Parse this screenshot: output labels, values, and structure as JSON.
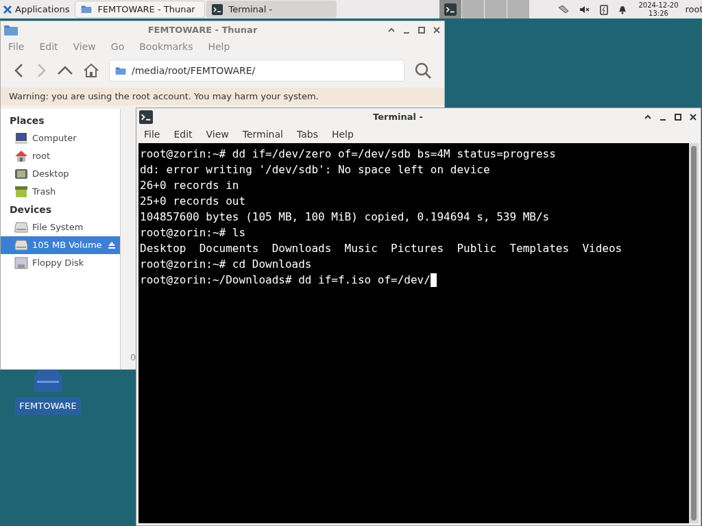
{
  "taskbar": {
    "menu_label": "Applications",
    "tasks": [
      {
        "label": "FEMTOWARE - Thunar",
        "kind": "folder",
        "selected": false
      },
      {
        "label": "Terminal -",
        "kind": "terminal",
        "selected": true
      }
    ],
    "workspaces": [
      {
        "selected": true
      },
      {
        "selected": false
      },
      {
        "selected": false
      },
      {
        "selected": false
      }
    ],
    "clock": {
      "date": "2024-12-20",
      "time": "13:26"
    },
    "user": "root"
  },
  "desktop_icon": {
    "label": "FEMTOWARE"
  },
  "file_manager": {
    "title": "FEMTOWARE - Thunar",
    "menu": [
      "File",
      "Edit",
      "View",
      "Go",
      "Bookmarks",
      "Help"
    ],
    "location": "/media/root/FEMTOWARE/",
    "warning": "Warning: you are using the root account. You may harm your system.",
    "sections": [
      {
        "heading": "Places",
        "items": [
          {
            "label": "Computer",
            "kind": "computer",
            "selected": false
          },
          {
            "label": "root",
            "kind": "home",
            "selected": false
          },
          {
            "label": "Desktop",
            "kind": "desktop",
            "selected": false
          },
          {
            "label": "Trash",
            "kind": "trash",
            "selected": false
          }
        ]
      },
      {
        "heading": "Devices",
        "items": [
          {
            "label": "File System",
            "kind": "drive",
            "selected": false
          },
          {
            "label": "105 MB Volume",
            "kind": "drive",
            "selected": true
          },
          {
            "label": "Floppy Disk",
            "kind": "floppy",
            "selected": false
          }
        ]
      }
    ],
    "status_text": "0"
  },
  "terminal": {
    "title": "Terminal -",
    "menu": [
      "File",
      "Edit",
      "View",
      "Terminal",
      "Tabs",
      "Help"
    ],
    "lines": [
      "root@zorin:~# dd if=/dev/zero of=/dev/sdb bs=4M status=progress",
      "dd: error writing '/dev/sdb': No space left on device",
      "26+0 records in",
      "25+0 records out",
      "104857600 bytes (105 MB, 100 MiB) copied, 0.194694 s, 539 MB/s",
      "root@zorin:~# ls",
      "Desktop  Documents  Downloads  Music  Pictures  Public  Templates  Videos",
      "root@zorin:~# cd Downloads",
      "root@zorin:~/Downloads# dd if=f.iso of=/dev/"
    ]
  }
}
